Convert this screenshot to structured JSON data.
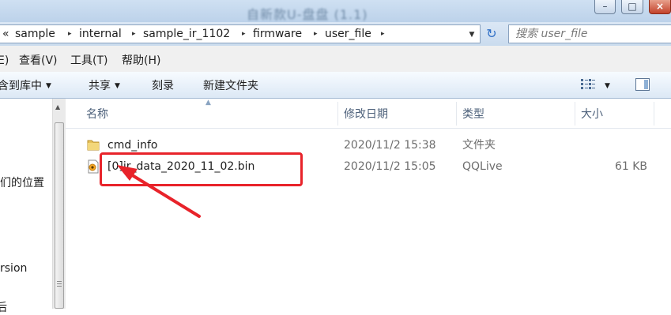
{
  "window": {
    "title": "自新款U-盘盘 (1.1)",
    "controls": {
      "minimize": "–",
      "maximize": "□",
      "close": "×"
    }
  },
  "address": {
    "overflow": "«",
    "crumbs": [
      "sample",
      "internal",
      "sample_ir_1102",
      "firmware",
      "user_file"
    ],
    "separator": "▸",
    "dropdown": "▼",
    "refresh": "↻"
  },
  "search": {
    "placeholder": "搜索 user_file"
  },
  "menu": {
    "items": [
      "E)",
      "查看(V)",
      "工具(T)",
      "帮助(H)"
    ]
  },
  "toolbar": {
    "include_library": "含到库中",
    "share": "共享",
    "burn": "刻录",
    "new_folder": "新建文件夹",
    "dropdown_arrow": "▼"
  },
  "nav": {
    "items": [
      "们的位置",
      "rsion",
      "后"
    ]
  },
  "columns": {
    "name": "名称",
    "date": "修改日期",
    "type": "类型",
    "size": "大小",
    "sort_arrow": "▲"
  },
  "files": [
    {
      "name": "cmd_info",
      "date": "2020/11/2 15:38",
      "type": "文件夹",
      "size": "",
      "icon": "folder-icon"
    },
    {
      "name": "[0]ir_data_2020_11_02.bin",
      "date": "2020/11/2 15:05",
      "type": "QQLive",
      "size": "61 KB",
      "icon": "qqlive-file-icon"
    }
  ],
  "annotation": {
    "color": "#e8232a"
  }
}
